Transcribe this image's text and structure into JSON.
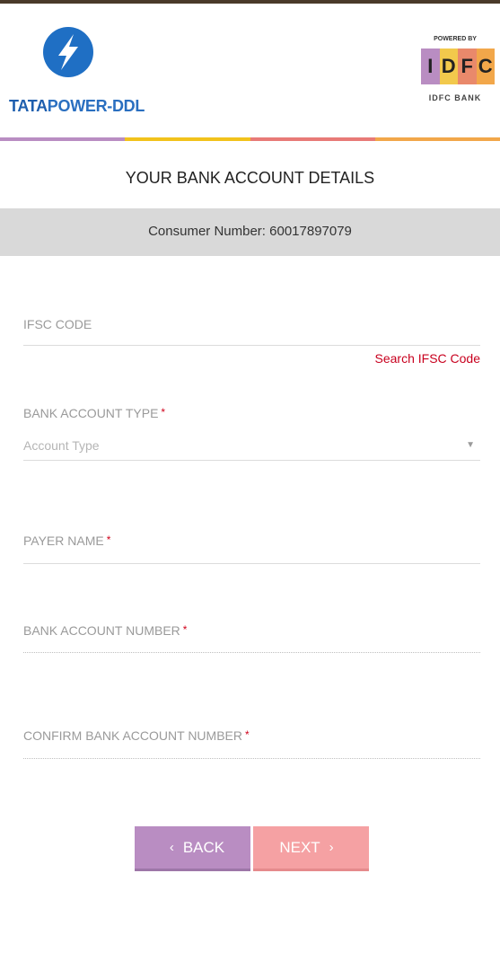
{
  "header": {
    "brand_name_bold": "TATA",
    "brand_name_rest": "POWER-DDL",
    "powered_by": "POWERED BY",
    "partner_letters": [
      "I",
      "D",
      "F",
      "C"
    ],
    "partner_name": "IDFC BANK",
    "brand_color": "#1f6fc4",
    "partner_colors": [
      "#b98dc2",
      "#f2c94c",
      "#e9896b",
      "#f2a74a"
    ]
  },
  "color_bar": [
    "#b98dc2",
    "#f2c21b",
    "#e87a77",
    "#f2a74a"
  ],
  "page": {
    "title": "YOUR BANK ACCOUNT DETAILS",
    "consumer_number": "Consumer Number: 60017897079"
  },
  "form": {
    "ifsc": {
      "label": "IFSC CODE",
      "value": "",
      "search_link": "Search IFSC Code"
    },
    "account_type": {
      "label": "BANK ACCOUNT TYPE",
      "required_mark": "*",
      "selected": "Account Type"
    },
    "payer_name": {
      "label": "PAYER NAME",
      "required_mark": "*",
      "value": ""
    },
    "account_number": {
      "label": "BANK ACCOUNT NUMBER",
      "required_mark": "*",
      "value": ""
    },
    "confirm_account_number": {
      "label": "CONFIRM BANK ACCOUNT NUMBER",
      "required_mark": "*",
      "value": ""
    }
  },
  "buttons": {
    "back_label": "BACK",
    "next_label": "NEXT",
    "back_icon": "chevron-left-icon",
    "next_icon": "chevron-right-icon"
  }
}
